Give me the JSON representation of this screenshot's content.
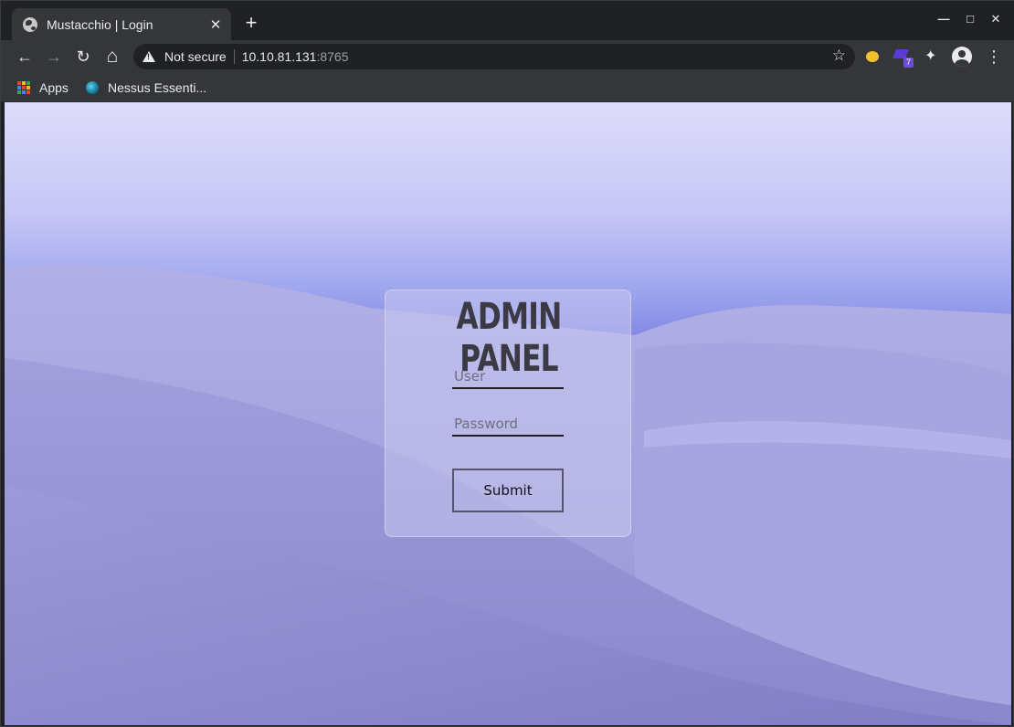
{
  "browser": {
    "tab": {
      "title": "Mustacchio | Login",
      "close_glyph": "✕"
    },
    "newtab_glyph": "+",
    "window_controls": {
      "minimize": "—",
      "maximize": "□",
      "close": "✕"
    },
    "nav": {
      "back": "←",
      "forward": "→",
      "reload": "↻",
      "home": "⌂"
    },
    "omnibox": {
      "security_text": "Not secure",
      "host": "10.10.81.131",
      "port": ":8765"
    },
    "extensions": {
      "purple_badge": "7"
    },
    "bookmarks": [
      {
        "label": "Apps",
        "icon": "apps-grid-icon"
      },
      {
        "label": "Nessus Essenti...",
        "icon": "nessus-icon"
      }
    ]
  },
  "login": {
    "title": "Admin Panel",
    "user_placeholder": "User",
    "password_placeholder": "Password",
    "submit_label": "Submit"
  },
  "colors": {
    "browser_dark": "#202124",
    "toolbar": "#35363a",
    "sky_top": "#dedcfb",
    "dune": "#8f8fd2"
  }
}
